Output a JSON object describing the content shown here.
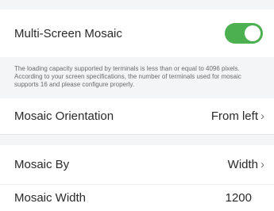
{
  "mosaic": {
    "label": "Multi-Screen Mosaic",
    "enabled": true,
    "note": "The loading capacity supported by terminals is less than or equal to 4096 pixels. According to your screen specifications, the number of terminals used for mosaic supports 16 and please configure properly."
  },
  "orientation": {
    "label": "Mosaic Orientation",
    "value": "From left"
  },
  "mosaic_by": {
    "label": "Mosaic By",
    "value": "Width"
  },
  "mosaic_width": {
    "label": "Mosaic Width",
    "value": "1200"
  },
  "icons": {
    "chevron": "chevron-right-icon"
  },
  "colors": {
    "toggle_on": "#4caf50",
    "background": "#f4f5f7"
  }
}
